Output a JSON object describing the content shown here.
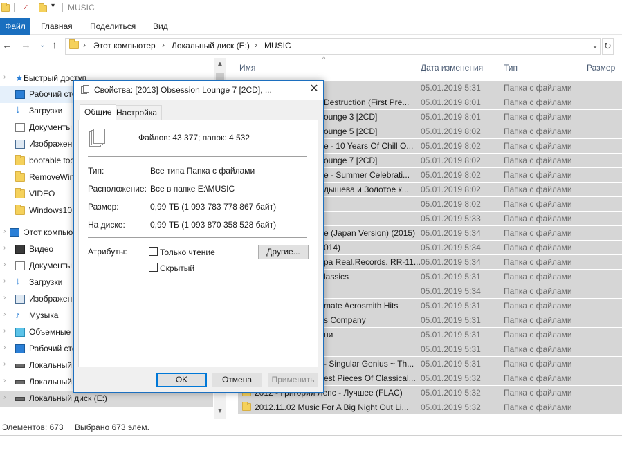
{
  "window": {
    "title": "MUSIC"
  },
  "ribbon": {
    "tabs": [
      "Файл",
      "Главная",
      "Поделиться",
      "Вид"
    ]
  },
  "address": {
    "parts": [
      "Этот компьютер",
      "Локальный диск (E:)",
      "MUSIC"
    ],
    "refresh_icon": "refresh-icon"
  },
  "nav": {
    "items": [
      {
        "label": "Быстрый доступ",
        "icon": "star-icon"
      },
      {
        "label": "Рабочий стол",
        "icon": "desktop-icon"
      },
      {
        "label": "Загрузки",
        "icon": "download-icon"
      },
      {
        "label": "Документы",
        "icon": "documents-icon"
      },
      {
        "label": "Изображения",
        "icon": "pictures-icon"
      },
      {
        "label": "bootable tool",
        "icon": "folder-icon"
      },
      {
        "label": "RemoveWin",
        "icon": "folder-icon"
      },
      {
        "label": "VIDEO",
        "icon": "folder-icon"
      },
      {
        "label": "Windows10",
        "icon": "folder-icon"
      },
      {
        "label": "Этот компьютер",
        "icon": "computer-icon"
      },
      {
        "label": "Видео",
        "icon": "video-icon"
      },
      {
        "label": "Документы",
        "icon": "documents-icon"
      },
      {
        "label": "Загрузки",
        "icon": "download-icon"
      },
      {
        "label": "Изображения",
        "icon": "pictures-icon"
      },
      {
        "label": "Музыка",
        "icon": "music-icon"
      },
      {
        "label": "Объемные",
        "icon": "3d-objects-icon"
      },
      {
        "label": "Рабочий стол",
        "icon": "desktop-icon"
      },
      {
        "label": "Локальный",
        "icon": "drive-icon"
      },
      {
        "label": "Локальный",
        "icon": "drive-icon"
      },
      {
        "label": "Локальный диск (E:)",
        "icon": "drive-icon"
      }
    ]
  },
  "filelist": {
    "columns": [
      "Имя",
      "Дата изменения",
      "Тип",
      "Размер"
    ],
    "rows": [
      {
        "name": "",
        "date": "05.01.2019 5:31",
        "type": "Папка с файлами"
      },
      {
        "name": "Destruction (First Pre...",
        "date": "05.01.2019 8:01",
        "type": "Папка с файлами"
      },
      {
        "name": "ounge 3 [2CD]",
        "date": "05.01.2019 8:01",
        "type": "Папка с файлами"
      },
      {
        "name": "ounge 5 [2CD]",
        "date": "05.01.2019 8:02",
        "type": "Папка с файлами"
      },
      {
        "name": "e - 10 Years Of Chill O...",
        "date": "05.01.2019 8:02",
        "type": "Папка с файлами"
      },
      {
        "name": "ounge 7 [2CD]",
        "date": "05.01.2019 8:02",
        "type": "Папка с файлами"
      },
      {
        "name": "e - Summer Celebrati...",
        "date": "05.01.2019 8:02",
        "type": "Папка с файлами"
      },
      {
        "name": "дышева и Золотое к...",
        "date": "05.01.2019 8:02",
        "type": "Папка с файлами"
      },
      {
        "name": "",
        "date": "05.01.2019 8:02",
        "type": "Папка с файлами"
      },
      {
        "name": "",
        "date": "05.01.2019 5:33",
        "type": "Папка с файлами"
      },
      {
        "name": "e (Japan Version) (2015)",
        "date": "05.01.2019 5:34",
        "type": "Папка с файлами"
      },
      {
        "name": "014)",
        "date": "05.01.2019 5:34",
        "type": "Папка с файлами"
      },
      {
        "name": "pa Real.Records. RR-11...",
        "date": "05.01.2019 5:34",
        "type": "Папка с файлами"
      },
      {
        "name": "lassics",
        "date": "05.01.2019 5:31",
        "type": "Папка с файлами"
      },
      {
        "name": "",
        "date": "05.01.2019 5:34",
        "type": "Папка с файлами"
      },
      {
        "name": "mate Aerosmith Hits",
        "date": "05.01.2019 5:31",
        "type": "Папка с файлами"
      },
      {
        "name": "s Company",
        "date": "05.01.2019 5:31",
        "type": "Папка с файлами"
      },
      {
        "name": "ни",
        "date": "05.01.2019 5:31",
        "type": "Папка с файлами"
      },
      {
        "name": "",
        "date": "05.01.2019 5:31",
        "type": "Папка с файлами"
      },
      {
        "name": "- Singular Genius ~ Th...",
        "date": "05.01.2019 5:31",
        "type": "Папка с файлами"
      },
      {
        "name": "est Pieces Of Classical...",
        "date": "05.01.2019 5:32",
        "type": "Папка с файлами"
      },
      {
        "name": "2012 - Григорий Лепс - Лучшее (FLAC)",
        "date": "05.01.2019 5:32",
        "type": "Папка с файлами"
      },
      {
        "name": "2012.11.02 Music For A Big Night Out Li...",
        "date": "05.01.2019 5:32",
        "type": "Папка с файлами"
      }
    ]
  },
  "status": {
    "count": "Элементов: 673",
    "selected": "Выбрано 673 элем."
  },
  "dialog": {
    "title": "Свойства: [2013] Obsession Lounge 7 [2CD], ...",
    "tabs": [
      "Общие",
      "Настройка"
    ],
    "summary": "Файлов: 43 377; папок: 4 532",
    "props": [
      {
        "label": "Тип:",
        "value": "Все типа Папка с файлами"
      },
      {
        "label": "Расположение:",
        "value": "Все в папке E:\\MUSIC"
      },
      {
        "label": "Размер:",
        "value": "0,99 ТБ (1 093 783 778 867 байт)"
      },
      {
        "label": "На диске:",
        "value": "0,99 ТБ (1 093 870 358 528 байт)"
      }
    ],
    "attributes_label": "Атрибуты:",
    "readonly_label": "Только чтение",
    "hidden_label": "Скрытый",
    "other_button": "Другие...",
    "ok": "OK",
    "cancel": "Отмена",
    "apply": "Применить"
  },
  "colors": {
    "accent": "#1a6fbf",
    "selection": "#d6d6d6",
    "folder": "#f5d15b"
  }
}
